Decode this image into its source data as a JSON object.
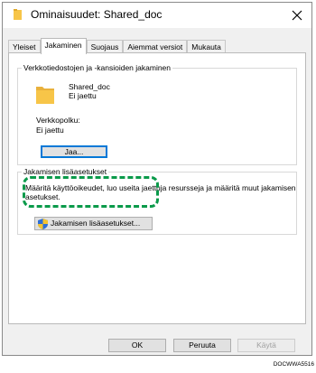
{
  "window": {
    "title": "Ominaisuudet: Shared_doc",
    "close_glyph": "✕"
  },
  "tabs": [
    {
      "label": "Yleiset",
      "active": false
    },
    {
      "label": "Jakaminen",
      "active": true
    },
    {
      "label": "Suojaus",
      "active": false
    },
    {
      "label": "Aiemmat versiot",
      "active": false
    },
    {
      "label": "Mukauta",
      "active": false
    }
  ],
  "network_sharing": {
    "group_title": "Verkkotiedostojen ja -kansioiden jakaminen",
    "folder_name": "Shared_doc",
    "folder_status": "Ei jaettu",
    "path_label": "Verkkopolku:",
    "path_value": "Ei jaettu",
    "share_button": "Jaa..."
  },
  "advanced_sharing": {
    "group_title": "Jakamisen lisäasetukset",
    "description": "Määritä käyttöoikeudet, luo useita jaettuja resursseja ja määritä muut jakamisen asetukset.",
    "button": "Jakamisen lisäasetukset...",
    "button_icon": "shield-icon"
  },
  "footer": {
    "ok": "OK",
    "cancel": "Peruuta",
    "apply": "Käytä"
  },
  "figure_code": "DOCWWA5516",
  "colors": {
    "folder": "#f7c548",
    "highlight": "#0a9a4a",
    "focus": "#0078d7"
  }
}
